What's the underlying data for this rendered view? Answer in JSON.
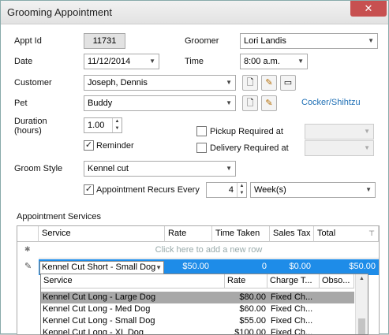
{
  "window": {
    "title": "Grooming Appointment",
    "close_glyph": "✕"
  },
  "form": {
    "appt_id_label": "Appt Id",
    "appt_id_value": "11731",
    "groomer_label": "Groomer",
    "groomer_value": "Lori Landis",
    "date_label": "Date",
    "date_value": "11/12/2014",
    "time_label": "Time",
    "time_value": "8:00 a.m.",
    "customer_label": "Customer",
    "customer_value": "Joseph, Dennis",
    "pet_label": "Pet",
    "pet_value": "Buddy",
    "pet_breed_link": "Cocker/Shihtzu",
    "duration_label_1": "Duration",
    "duration_label_2": "(hours)",
    "duration_value": "1.00",
    "reminder_label": "Reminder",
    "reminder_checked": true,
    "pickup_label": "Pickup Required at",
    "pickup_checked": false,
    "delivery_label": "Delivery Required at",
    "delivery_checked": false,
    "groom_style_label": "Groom Style",
    "groom_style_value": "Kennel cut",
    "recurs_label": "Appointment Recurs Every",
    "recurs_checked": true,
    "recurs_count": "4",
    "recurs_unit": "Week(s)"
  },
  "icons": {
    "new": "🗋",
    "edit": "✎",
    "card": "▭",
    "down_arrow": "▼",
    "spin_up": "▲",
    "spin_down": "▼",
    "checkmark": "✓",
    "new_row_marker": "✱",
    "edit_row_marker": "✎",
    "filter": "⊤"
  },
  "services": {
    "section_label": "Appointment Services",
    "columns": [
      "Service",
      "Rate",
      "Time Taken",
      "Sales Tax",
      "Total"
    ],
    "new_row_hint": "Click here to add a new row",
    "selected_row": {
      "service": "Kennel Cut Short - Small Dog",
      "rate": "$50.00",
      "time_taken": "0",
      "sales_tax": "$0.00",
      "total": "$50.00"
    }
  },
  "dropdown": {
    "columns": [
      "Service",
      "Rate",
      "Charge T...",
      "Obso..."
    ],
    "rows": [
      {
        "service": "Kennel Cut Long - Large Dog",
        "rate": "$80.00",
        "charge": "Fixed Ch...",
        "highlighted": true
      },
      {
        "service": "Kennel Cut Long - Med Dog",
        "rate": "$60.00",
        "charge": "Fixed Ch...",
        "highlighted": false
      },
      {
        "service": "Kennel Cut Long - Small Dog",
        "rate": "$55.00",
        "charge": "Fixed Ch...",
        "highlighted": false
      },
      {
        "service": "Kennel Cut Long - XL Dog",
        "rate": "$100.00",
        "charge": "Fixed Ch...",
        "highlighted": false
      }
    ]
  },
  "colors": {
    "selection": "#1e8ce8",
    "dropdown_highlight": "#a8a8a8",
    "link": "#1e6fb5",
    "close_button": "#c75050"
  }
}
